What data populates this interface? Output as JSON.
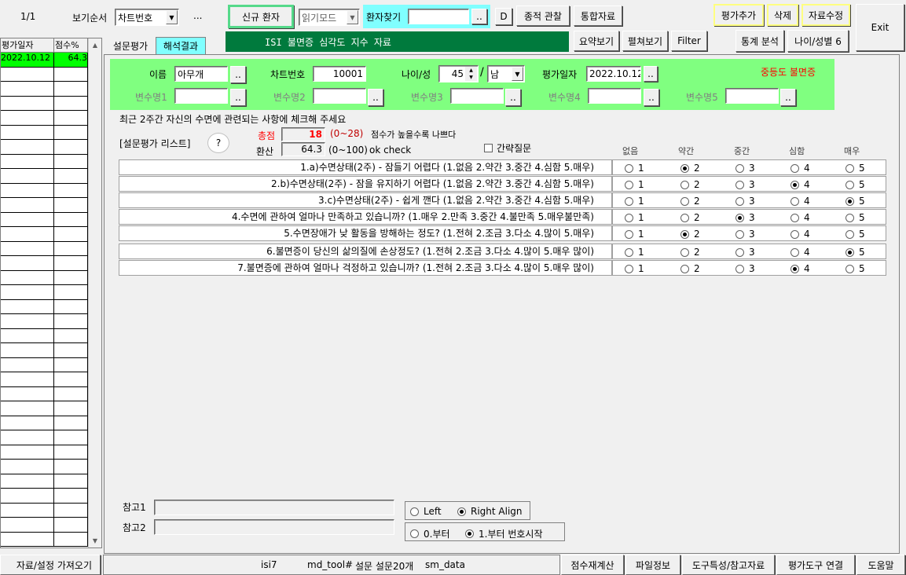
{
  "toolbar": {
    "page_counter": "1/1",
    "sort_label": "보기순서",
    "sort_value": "차트번호",
    "ellipsis": "...",
    "new_patient": "신규 환자",
    "read_mode": "읽기모드",
    "find_patient": "환자찾기",
    "find_value": "",
    "dots": "..",
    "d_button": "D",
    "follow_up": "종적 관찰",
    "integrated": "통합자료",
    "title_bar": "ISI 불면증 심각도 지수 자료",
    "summary": "요약보기",
    "expand": "펼쳐보기",
    "filter": "Filter",
    "add_eval": "평가추가",
    "delete": "삭제",
    "edit": "자료수정",
    "stats": "통계 분석",
    "age_sex": "나이/성별 6",
    "exit": "Exit"
  },
  "grid": {
    "headers": [
      "평가일자",
      "점수%"
    ],
    "rows": [
      {
        "date": "2022.10.12",
        "score": "64.3"
      }
    ]
  },
  "tabs": [
    "설문평가",
    "해석결과"
  ],
  "patient": {
    "name_label": "이름",
    "name_value": "아무개",
    "chart_label": "차트번호",
    "chart_value": "10001",
    "age_sex_label": "나이/성",
    "age_value": "45",
    "slash": "/",
    "sex_value": "남",
    "date_label": "평가일자",
    "date_value": "2022.10.12",
    "severity": "중등도 불면증",
    "var1": "변수명1",
    "var2": "변수명2",
    "var3": "변수명3",
    "var4": "변수명4",
    "var5": "변수명5",
    "btn_dots": ".."
  },
  "survey": {
    "instruction": "최근 2주간 자신의 수면에 관련되는 사항에 체크해 주세요",
    "list_label": "[설문평가 리스트]",
    "help": "?",
    "total_label": "총점",
    "total_value": "18",
    "total_range": "(0~28)",
    "total_note": "점수가 높을수록 나쁘다",
    "converted_label": "환산",
    "converted_value": "64.3",
    "converted_range": "(0~100)",
    "ok_check": "ok check",
    "brief_label": "간략질문",
    "scale": [
      "없음",
      "약간",
      "중간",
      "심함",
      "매우"
    ]
  },
  "questions": [
    {
      "text": "1.a)수면상태(2주) - 잠들기 어렵다         (1.없음 2.약간 3.중간 4.심함 5.매우)",
      "selected": 2
    },
    {
      "text": "2.b)수면상태(2주) - 잠을 유지하기 어렵다  (1.없음 2.약간 3.중간 4.심함 5.매우)",
      "selected": 4
    },
    {
      "text": "3.c)수면상태(2주) - 쉽게 깬다             (1.없음 2.약간 3.중간 4.심함 5.매우)",
      "selected": 5
    },
    {
      "text": "4.수면에 관하여 얼마나 만족하고 있습니까? (1.매우 2.만족 3.중간 4.불만족 5.매우불만족)",
      "selected": 3
    },
    {
      "text": "5.수면장애가 낮 활동을 방해하는 정도? (1.전혀 2.조금 3.다소 4.많이 5.매우)",
      "selected": 2
    },
    {
      "text": "6.불면증이 당신의 삶의질에 손상정도? (1.전혀 2.조금 3.다소 4.많이 5.매우 많이)",
      "selected": 5
    },
    {
      "text": "7.불면증에 관하여 얼마나 걱정하고 있습니까? (1.전혀 2.조금 3.다소 4.많이 5.매우 많이)",
      "selected": 4
    }
  ],
  "options": [
    "1",
    "2",
    "3",
    "4",
    "5"
  ],
  "notes": {
    "ref1": "참고1",
    "ref2": "참고2",
    "left": "Left",
    "right_align": "Right Align",
    "from0": "0.부터",
    "from1": "1.부터 번호시작"
  },
  "statusbar": {
    "load": "자료/설정 가져오기",
    "item1": "isi7",
    "item2": "md_tool#",
    "item3": "설문 설문20개",
    "item4": "sm_data",
    "recalc": "점수재계산",
    "file_info": "파일정보",
    "tool_info": "도구특성/참고자료",
    "link_tool": "평가도구 연결",
    "help": "도움말"
  },
  "colors": {
    "green_panel": "#80ff80",
    "title_bar": "#007a3d",
    "cyan": "#80ffff",
    "selected_row": "#00ff00",
    "red": "#ff0000"
  }
}
